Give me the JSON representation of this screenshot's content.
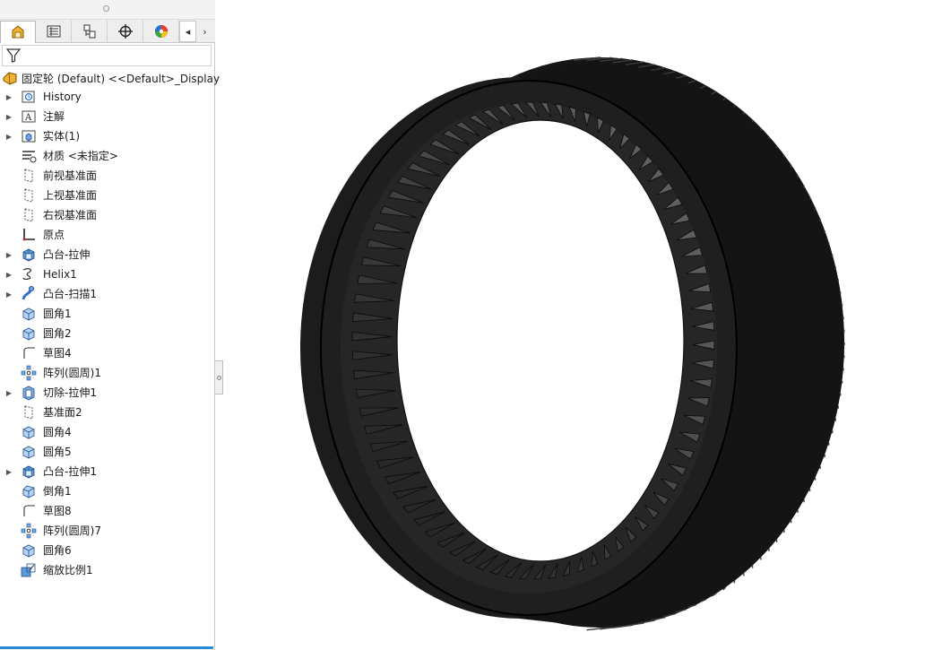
{
  "tabs": [
    {
      "name": "FeatureManager",
      "icon": "feature-manager-icon"
    },
    {
      "name": "PropertyManager",
      "icon": "property-manager-icon"
    },
    {
      "name": "ConfigurationManager",
      "icon": "configuration-manager-icon"
    },
    {
      "name": "DimXpertManager",
      "icon": "dimxpert-icon"
    },
    {
      "name": "DisplayManager",
      "icon": "display-manager-icon"
    }
  ],
  "tree": {
    "root_label": "固定轮 (Default) <<Default>_Display",
    "items": [
      {
        "label": "History",
        "icon": "history-icon",
        "expandable": true
      },
      {
        "label": "注解",
        "icon": "annotations-icon",
        "expandable": true
      },
      {
        "label": "实体(1)",
        "icon": "solid-bodies-icon",
        "expandable": true
      },
      {
        "label": "材质 <未指定>",
        "icon": "material-icon",
        "expandable": false
      },
      {
        "label": "前视基准面",
        "icon": "plane-icon",
        "expandable": false
      },
      {
        "label": "上视基准面",
        "icon": "plane-icon",
        "expandable": false
      },
      {
        "label": "右视基准面",
        "icon": "plane-icon",
        "expandable": false
      },
      {
        "label": "原点",
        "icon": "origin-icon",
        "expandable": false
      },
      {
        "label": "凸台-拉伸",
        "icon": "extrude-icon",
        "expandable": true
      },
      {
        "label": "Helix1",
        "icon": "helix-icon",
        "expandable": true
      },
      {
        "label": "凸台-扫描1",
        "icon": "sweep-icon",
        "expandable": true
      },
      {
        "label": "圆角1",
        "icon": "fillet-icon",
        "expandable": false
      },
      {
        "label": "圆角2",
        "icon": "fillet-icon",
        "expandable": false
      },
      {
        "label": "草图4",
        "icon": "sketch-icon",
        "expandable": false
      },
      {
        "label": "阵列(圆周)1",
        "icon": "circular-pattern-icon",
        "expandable": false
      },
      {
        "label": "切除-拉伸1",
        "icon": "cut-extrude-icon",
        "expandable": true
      },
      {
        "label": "基准面2",
        "icon": "plane-icon",
        "expandable": false
      },
      {
        "label": "圆角4",
        "icon": "fillet-icon",
        "expandable": false
      },
      {
        "label": "圆角5",
        "icon": "fillet-icon",
        "expandable": false
      },
      {
        "label": "凸台-拉伸1",
        "icon": "extrude-icon",
        "expandable": true
      },
      {
        "label": "倒角1",
        "icon": "chamfer-icon",
        "expandable": false
      },
      {
        "label": "草图8",
        "icon": "sketch-icon",
        "expandable": false
      },
      {
        "label": "阵列(圆周)7",
        "icon": "circular-pattern-icon",
        "expandable": false
      },
      {
        "label": "圆角6",
        "icon": "fillet-icon",
        "expandable": false
      },
      {
        "label": "缩放比例1",
        "icon": "scale-icon",
        "expandable": false
      }
    ]
  },
  "colors": {
    "accent": "#2b8ad8",
    "gear_face": "#1f1f1f",
    "gear_edge": "#000000"
  }
}
